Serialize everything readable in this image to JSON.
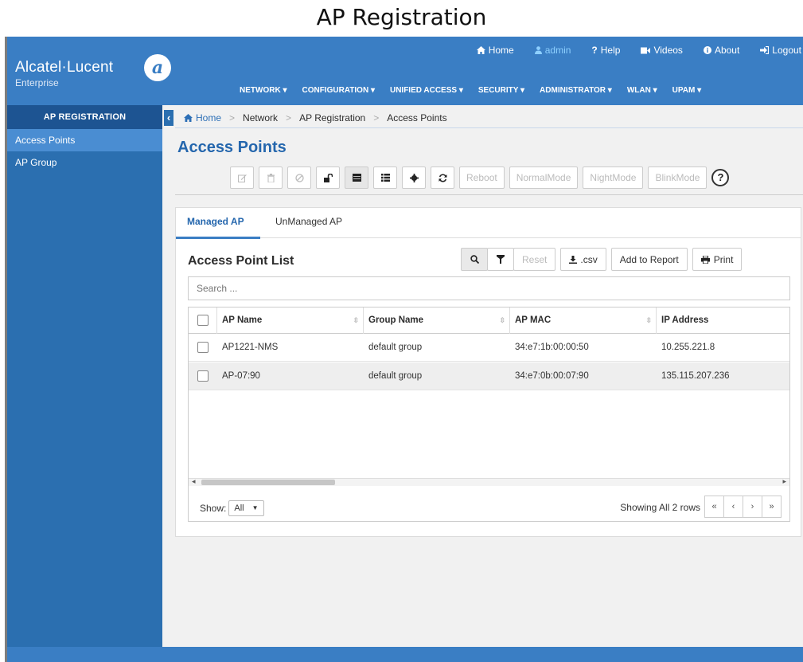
{
  "caption": "AP Registration",
  "header": {
    "logo_text": "Alcatel·Lucent",
    "logo_sub": "Enterprise",
    "links": [
      {
        "icon": "home-icon",
        "label": "Home"
      },
      {
        "icon": "user-icon",
        "label": "admin"
      },
      {
        "icon": "help-icon",
        "label": "Help"
      },
      {
        "icon": "video-icon",
        "label": "Videos"
      },
      {
        "icon": "info-icon",
        "label": "About"
      },
      {
        "icon": "logout-icon",
        "label": "Logout"
      }
    ],
    "menu": [
      "NETWORK ▾",
      "CONFIGURATION ▾",
      "UNIFIED ACCESS ▾",
      "SECURITY ▾",
      "ADMINISTRATOR ▾",
      "WLAN ▾",
      "UPAM ▾"
    ]
  },
  "sidebar": {
    "title": "AP REGISTRATION",
    "items": [
      "Access Points",
      "AP Group"
    ]
  },
  "breadcrumb": [
    "Home",
    "Network",
    "AP Registration",
    "Access Points"
  ],
  "page_title": "Access Points",
  "toolbar": {
    "reboot": "Reboot",
    "normal": "NormalMode",
    "night": "NightMode",
    "blink": "BlinkMode",
    "help": "?"
  },
  "tabs": [
    "Managed AP",
    "UnManaged AP"
  ],
  "list": {
    "title": "Access Point List",
    "reset": "Reset",
    "csv": ".csv",
    "add_report": "Add to Report",
    "print": "Print",
    "search_placeholder": "Search ...",
    "columns": [
      "AP Name",
      "Group Name",
      "AP MAC",
      "IP Address"
    ],
    "rows": [
      {
        "name": "AP1221-NMS",
        "group": "default group",
        "mac": "34:e7:1b:00:00:50",
        "ip": "10.255.221.8"
      },
      {
        "name": "AP-07:90",
        "group": "default group",
        "mac": "34:e7:0b:00:07:90",
        "ip": "135.115.207.236"
      }
    ],
    "show_label": "Show:",
    "show_value": "All",
    "showing": "Showing All 2 rows",
    "pager": [
      "«",
      "‹",
      "›",
      "»"
    ]
  },
  "colors": {
    "header": "#3a7ec4",
    "sidebar": "#2b6fb0",
    "sidebar_head": "#1d5492",
    "title": "#2466ad"
  }
}
